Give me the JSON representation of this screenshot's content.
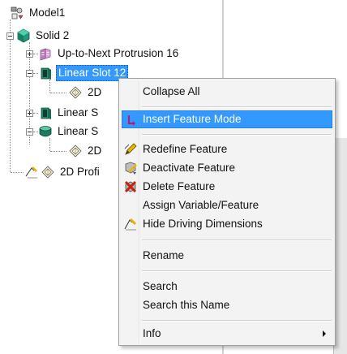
{
  "tree": {
    "items": [
      {
        "label": "Model1"
      },
      {
        "label": "Solid 2"
      },
      {
        "label": "Up-to-Next Protrusion 16"
      },
      {
        "label": "Linear Slot 12"
      },
      {
        "label": "2D"
      },
      {
        "label": "Linear S"
      },
      {
        "label": "Linear S"
      },
      {
        "label": "2D"
      },
      {
        "label": "2D Profi"
      }
    ]
  },
  "context_menu": {
    "items": [
      {
        "label": "Collapse All",
        "icon": ""
      },
      {
        "label": "Insert Feature Mode",
        "icon": "insert-arrow-icon"
      },
      {
        "label": "Redefine Feature",
        "icon": "redefine-pencil-icon"
      },
      {
        "label": "Deactivate Feature",
        "icon": "deactivate-icon"
      },
      {
        "label": "Delete Feature",
        "icon": "delete-feature-icon"
      },
      {
        "label": "Assign Variable/Feature",
        "icon": ""
      },
      {
        "label": "Hide Driving Dimensions",
        "icon": "dimension-icon"
      },
      {
        "label": "Rename",
        "icon": ""
      },
      {
        "label": "Search",
        "icon": ""
      },
      {
        "label": "Search this Name",
        "icon": ""
      },
      {
        "label": "Info",
        "icon": "",
        "has_submenu": true
      }
    ],
    "highlighted": "Insert Feature Mode"
  },
  "colors": {
    "selection": "#3399ff",
    "menu_background": "#f3f3f3"
  }
}
